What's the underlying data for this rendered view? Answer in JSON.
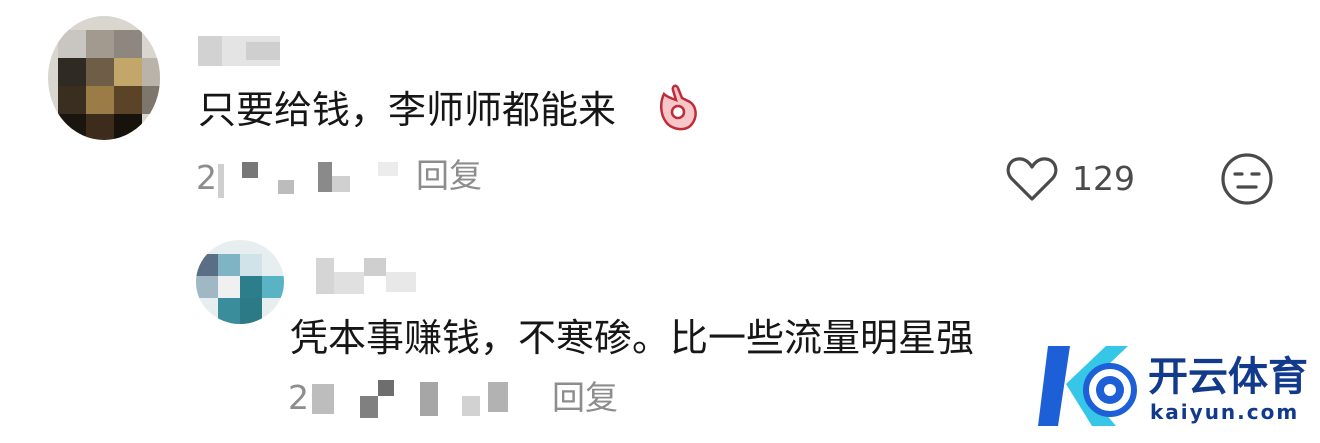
{
  "comments": [
    {
      "text": "只要给钱，李师师都能来",
      "date_visible": "2",
      "reply_label": "回复",
      "like_count": "129"
    },
    {
      "text": "凭本事赚钱，不寒碜。比一些流量明星强",
      "date_visible": "2",
      "reply_label": "回复"
    }
  ],
  "icons": {
    "like": "heart-outline-icon",
    "dislike": "neutral-face-icon",
    "reaction": "ok-hand-emoji"
  },
  "watermark": {
    "brand": "开云体育",
    "site": "kaiyun.com"
  },
  "colors": {
    "meta_gray": "#8d8d8d",
    "text": "#161616",
    "brand_blue": "#123a8c",
    "brand_cyan": "#36c6e8"
  }
}
